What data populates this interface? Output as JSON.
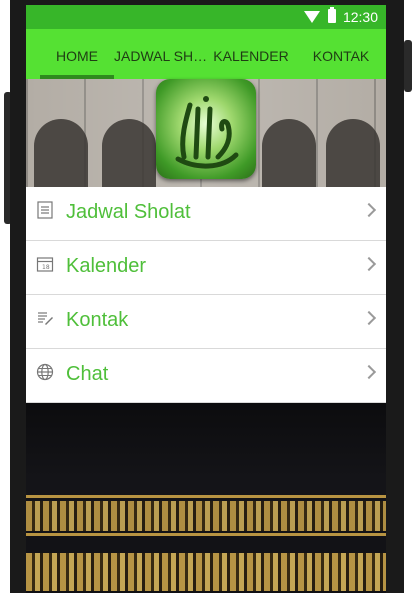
{
  "status_bar": {
    "time": "12:30",
    "icons": [
      "wifi-icon",
      "battery-icon"
    ]
  },
  "tabs": [
    {
      "label": "HOME",
      "active": true
    },
    {
      "label": "JADWAL SHOLAT",
      "active": false
    },
    {
      "label": "KALENDER",
      "active": false
    },
    {
      "label": "KONTAK",
      "active": false
    }
  ],
  "header": {
    "badge_icon": "allah-calligraphy-icon"
  },
  "menu": [
    {
      "label": "Jadwal Sholat",
      "icon": "document-icon"
    },
    {
      "label": "Kalender",
      "icon": "calendar-icon"
    },
    {
      "label": "Kontak",
      "icon": "edit-icon"
    },
    {
      "label": "Chat",
      "icon": "globe-icon"
    }
  ],
  "colors": {
    "status_bar": "#37b629",
    "tab_bar": "#55e133",
    "menu_text": "#4fbf3a"
  }
}
